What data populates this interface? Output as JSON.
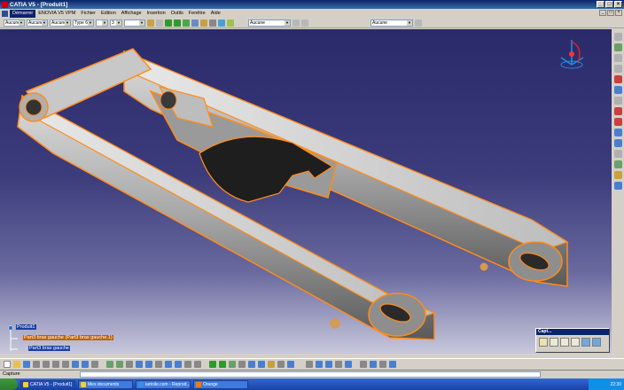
{
  "window": {
    "title": "CATIA V5 - [Produit1]"
  },
  "menu": {
    "items": [
      "Démarrer",
      "ENOVIA V5 VPM",
      "Fichier",
      "Edition",
      "Affichage",
      "Insertion",
      "Outils",
      "Fenêtre",
      "Aide"
    ]
  },
  "toolbar": {
    "combo1": "Aucune",
    "combo2": "Aucune",
    "combo3": "Aucune",
    "combo4": "Type 6",
    "linewidth_value": "3",
    "combo_layer": "Aucune",
    "combo_right": "Aucune"
  },
  "tree": {
    "root": "Produit1",
    "child1": "Part3 bras gauche (Part3 bras gauche.1)",
    "child2": "Part3 bras gauche"
  },
  "capture_panel": {
    "title": "Capt..."
  },
  "status": {
    "text": "Capture"
  },
  "taskbar": {
    "items": [
      "CATIA V5 - [Produit1]",
      "Mes documents",
      "iartoile.com - Reprod...",
      "Orange"
    ],
    "clock": "22:30"
  },
  "colors": {
    "viewport_top": "#2a2a6a",
    "viewport_bottom": "#c8c8dc",
    "highlight": "#ff8c1a",
    "selection": "#1a3fa0"
  }
}
